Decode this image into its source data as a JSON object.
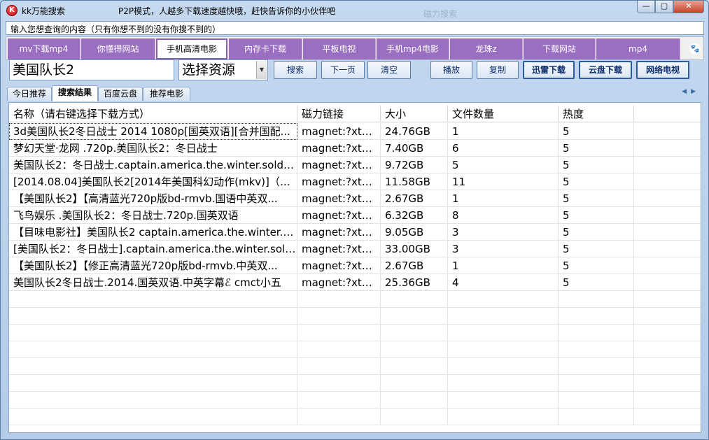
{
  "window": {
    "title": "kk万能搜索",
    "subtitle": "P2P模式，人越多下载速度越快哦，赶快告诉你的小伙伴吧",
    "ghost_text": "磁力搜索",
    "controls": {
      "minimize": "—",
      "maximize": "▢",
      "close": "✕"
    }
  },
  "hint": "输入您想查询的内容（只有你想不到的没有你搜不到的）",
  "categories": [
    "mv下载mp4",
    "你懂得网站",
    "手机高清电影",
    "内存卡下载",
    "平板电视",
    "手机mp4电影",
    "龙珠z",
    "下载网站",
    "mp4"
  ],
  "active_category_index": 2,
  "search": {
    "value": "美国队长2"
  },
  "source_select": {
    "value": "选择资源"
  },
  "buttons": {
    "search": "搜索",
    "next_page": "下一页",
    "clear": "清空",
    "play": "播放",
    "copy": "复制",
    "xunlei": "迅雷下载",
    "cloud": "云盘下载",
    "tv": "网络电视"
  },
  "tabs": [
    "今日推荐",
    "搜索结果",
    "百度云盘",
    "推荐电影"
  ],
  "active_tab_index": 1,
  "table": {
    "headers": [
      "名称（请右键选择下载方式）",
      "磁力链接",
      "大小",
      "文件数量",
      "热度"
    ],
    "rows": [
      [
        "3d美国队长2冬日战士 2014  1080p[国英双语][合并国配...",
        "magnet:?xt=...",
        "24.76GB",
        "1",
        "5"
      ],
      [
        "梦幻天堂·龙网 .720p.美国队长2：冬日战士",
        "magnet:?xt=...",
        "7.40GB",
        "6",
        "5"
      ],
      [
        "美国队长2：冬日战士.captain.america.the.winter.soldie...",
        "magnet:?xt=...",
        "9.72GB",
        "5",
        "5"
      ],
      [
        "[2014.08.04]美国队长2[2014年美国科幻动作(mkv)]（帝...",
        "magnet:?xt=...",
        "11.58GB",
        "11",
        "5"
      ],
      [
        "【美国队长2】【高清蓝光720p版bd-rmvb.国语中英双...",
        "magnet:?xt=...",
        "2.67GB",
        "1",
        "5"
      ],
      [
        "飞鸟娱乐 .美国队长2：冬日战士.720p.国英双语",
        "magnet:?xt=...",
        "6.32GB",
        "8",
        "5"
      ],
      [
        "【目味电影社】美国队长2 captain.america.the.winter.s...",
        "magnet:?xt=...",
        "9.05GB",
        "3",
        "5"
      ],
      [
        "[美国队长2：冬日战士].captain.america.the.winter.soldi...",
        "magnet:?xt=...",
        "33.00GB",
        "3",
        "5"
      ],
      [
        "【美国队长2】【修正高清蓝光720p版bd-rmvb.中英双...",
        "magnet:?xt=...",
        "2.67GB",
        "1",
        "5"
      ],
      [
        "美国队长2冬日战士.2014.国英双语.中英字幕ℰ cmct小五",
        "magnet:?xt=...",
        "25.36GB",
        "4",
        "5"
      ]
    ]
  },
  "colors": {
    "category_bg": "#9a6ec0",
    "title_bg": "#c4d8ef",
    "button_text": "#0a2a6a"
  }
}
